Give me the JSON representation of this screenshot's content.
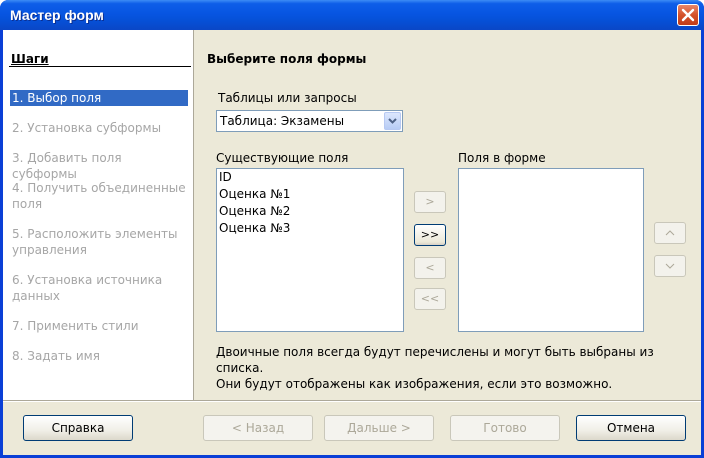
{
  "window": {
    "title": "Мастер форм"
  },
  "steps": {
    "title": "Шаги",
    "items": [
      {
        "label": "1. Выбор поля",
        "active": true
      },
      {
        "label": "2. Установка субформы"
      },
      {
        "label": "3. Добавить поля субформы"
      },
      {
        "label": "4. Получить объединенные поля"
      },
      {
        "label": "5. Расположить элементы управления"
      },
      {
        "label": "6. Установка источника данных"
      },
      {
        "label": "7. Применить стили"
      },
      {
        "label": "8. Задать имя"
      }
    ]
  },
  "page": {
    "heading": "Выберите поля формы",
    "tables_label": "Таблицы или запросы",
    "tables_selected": "Таблица: Экзамены",
    "existing_label": "Существующие поля",
    "existing_fields": [
      "ID",
      "Оценка №1",
      "Оценка №2",
      "Оценка №3"
    ],
    "form_fields_label": "Поля в форме",
    "form_fields": [],
    "move_buttons": {
      "add_one": ">",
      "add_all": ">>",
      "remove_one": "<",
      "remove_all": "<<"
    },
    "order_buttons": {
      "up": "^",
      "down": "v"
    },
    "note_line1": "Двоичные поля всегда будут перечислены и могут быть выбраны из списка.",
    "note_line2": "Они будут отображены как изображения, если это возможно."
  },
  "buttons": {
    "help": "Справка",
    "back": "< Назад",
    "next": "Дальше >",
    "finish": "Готово",
    "cancel": "Отмена"
  },
  "colors": {
    "titlebar": "#0755e2",
    "selection": "#316ac5",
    "face": "#ece9d8",
    "close": "#d4512a"
  }
}
